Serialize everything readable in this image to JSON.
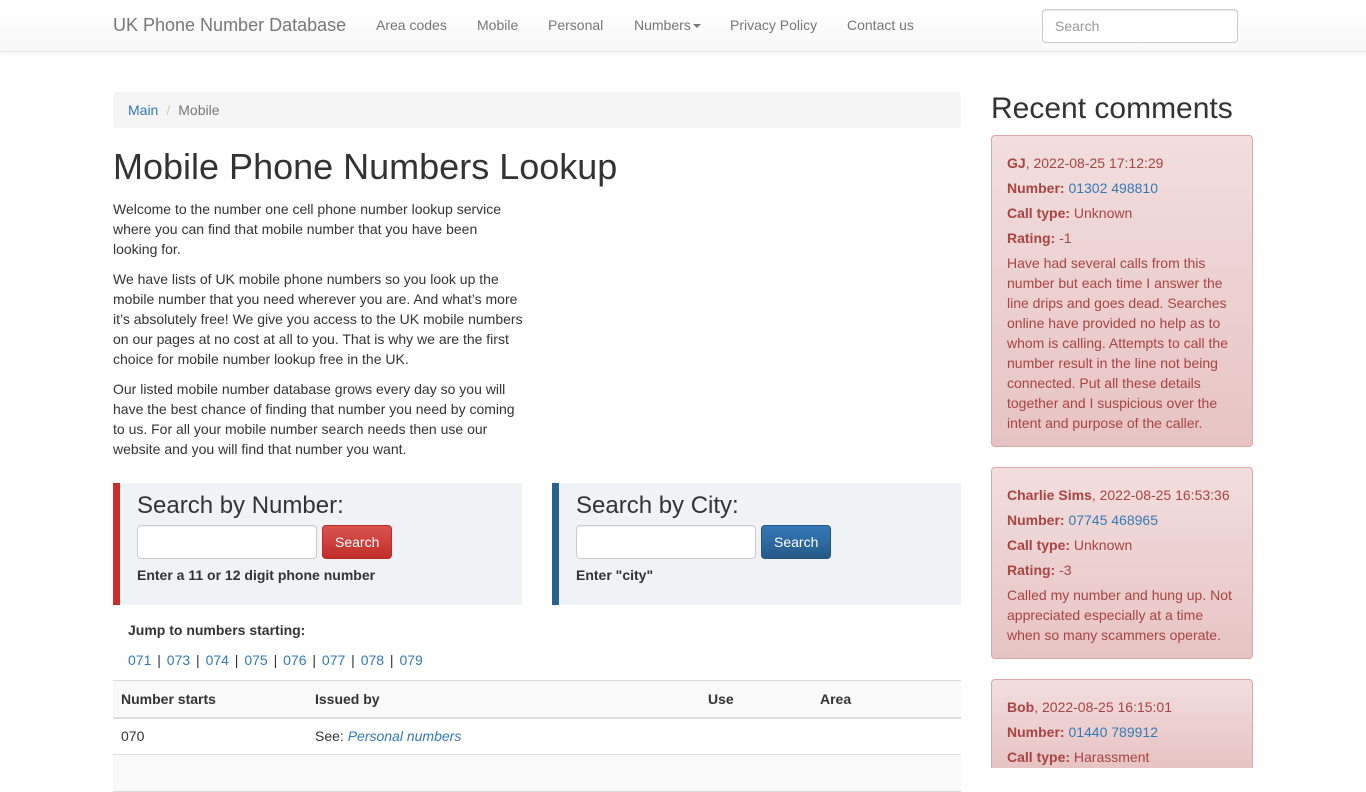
{
  "navbar": {
    "brand": "UK Phone Number Database",
    "items": [
      {
        "label": "Area codes"
      },
      {
        "label": "Mobile"
      },
      {
        "label": "Personal"
      },
      {
        "label": "Numbers"
      },
      {
        "label": "Privacy Policy"
      },
      {
        "label": "Contact us"
      }
    ],
    "search_placeholder": "Search"
  },
  "breadcrumb": {
    "home": "Main",
    "current": "Mobile"
  },
  "page": {
    "title": "Mobile Phone Numbers Lookup",
    "paragraphs": [
      "Welcome to the number one cell phone number lookup service where you can find that mobile number that you have been looking for.",
      "We have lists of UK mobile phone numbers so you look up the mobile number that you need wherever you are. And what’s more it’s absolutely free! We give you access to the UK mobile numbers on our pages at no cost at all to you. That is why we are the first choice for mobile number lookup free in the UK.",
      "Our listed mobile number database grows every day so you will have the best chance of finding that number you need by coming to us. For all your mobile number search needs then use our website and you will find that number you want."
    ]
  },
  "search_number": {
    "title": "Search by Number:",
    "button": "Search",
    "hint": "Enter a 11 or 12 digit phone number",
    "value": ""
  },
  "search_city": {
    "title": "Search by City:",
    "button": "Search",
    "hint": "Enter \"city\"",
    "value": ""
  },
  "jump": {
    "title": "Jump to numbers starting:",
    "links": [
      "071",
      "073",
      "074",
      "075",
      "076",
      "077",
      "078",
      "079"
    ]
  },
  "table": {
    "headers": [
      "Number starts",
      "Issued by",
      "Use",
      "Area"
    ],
    "rows": [
      {
        "start": "070",
        "issued_prefix": "See:",
        "issued_link": "Personal numbers",
        "use": "",
        "area": ""
      }
    ]
  },
  "sidebar": {
    "title": "Recent comments",
    "number_label": "Number:",
    "calltype_label": "Call type:",
    "rating_label": "Rating:",
    "comments": [
      {
        "author": "GJ",
        "date": "2022-08-25 17:12:29",
        "number": "01302 498810",
        "call_type": "Unknown",
        "rating": "-1",
        "text": "Have had several calls from this number but each time I answer the line drips and goes dead. Searches online have provided no help as to whom is calling. Attempts to call the number result in the line not being connected. Put all these details together and I suspicious over the intent and purpose of the caller."
      },
      {
        "author": "Charlie Sims",
        "date": "2022-08-25 16:53:36",
        "number": "07745 468965",
        "call_type": "Unknown",
        "rating": "-3",
        "text": "Called my number and hung up. Not appreciated especially at a time when so many scammers operate."
      },
      {
        "author": "Bob",
        "date": "2022-08-25 16:15:01",
        "number": "01440 789912",
        "call_type": "Harassment",
        "rating": "",
        "text": ""
      }
    ]
  },
  "colors": {
    "accent_link": "#337ab7",
    "danger": "#c9302c",
    "primary": "#286090",
    "alert_text": "#a94442"
  }
}
